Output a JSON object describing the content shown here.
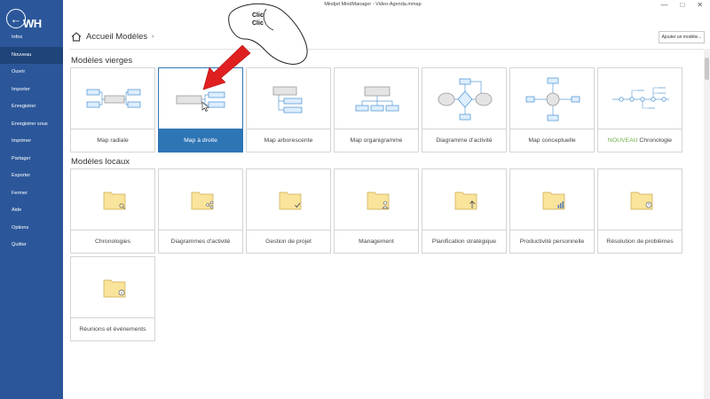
{
  "window": {
    "title": "Mindjet MindManager - Video-Agenda.mmap",
    "minimize": "—",
    "maximize": "□",
    "close": "✕"
  },
  "sidebar": {
    "logo_text": "WH",
    "items": [
      {
        "id": "infos",
        "label": "Infos"
      },
      {
        "id": "nouveau",
        "label": "Nouveau",
        "active": true
      },
      {
        "id": "ouvrir",
        "label": "Ouvrir"
      },
      {
        "id": "importer",
        "label": "Importer"
      },
      {
        "id": "enregistrer",
        "label": "Enregistrer"
      },
      {
        "id": "enregistrer-sous",
        "label": "Enregistrer sous"
      },
      {
        "id": "imprimer",
        "label": "Imprimer"
      },
      {
        "id": "partager",
        "label": "Partager"
      },
      {
        "id": "exporter",
        "label": "Exporter"
      },
      {
        "id": "fermer",
        "label": "Fermer"
      },
      {
        "id": "aide",
        "label": "Aide"
      },
      {
        "id": "options",
        "label": "Options"
      },
      {
        "id": "quitter",
        "label": "Quitter"
      }
    ]
  },
  "header": {
    "breadcrumb": "Accueil Modèles",
    "breadcrumb_chevron": "›",
    "add_model_label": "Ajouter un modèle..."
  },
  "annotation": {
    "line1": "Clic",
    "line2": "Clic"
  },
  "blank_templates": {
    "title": "Modèles vierges",
    "items": [
      {
        "id": "radiale",
        "label": "Map radiale"
      },
      {
        "id": "droite",
        "label": "Map à droite",
        "selected": true
      },
      {
        "id": "arborescente",
        "label": "Map arborescente"
      },
      {
        "id": "organigramme",
        "label": "Map organigramme"
      },
      {
        "id": "activite",
        "label": "Diagramme d'activité"
      },
      {
        "id": "conceptuelle",
        "label": "Map conceptuelle"
      },
      {
        "id": "chronologie",
        "badge": "NOUVEAU",
        "label": "Chronologie"
      }
    ]
  },
  "local_templates": {
    "title": "Modèles locaux",
    "items": [
      {
        "id": "chronologies",
        "label": "Chronologies",
        "glyph": "magnifier"
      },
      {
        "id": "diagrammes",
        "label": "Diagrammes d'activité",
        "glyph": "share"
      },
      {
        "id": "gestion",
        "label": "Gestion de projet",
        "glyph": "check"
      },
      {
        "id": "management",
        "label": "Management",
        "glyph": "person"
      },
      {
        "id": "planification",
        "label": "Planification stratégique",
        "glyph": "arrow"
      },
      {
        "id": "productivite",
        "label": "Productivité personnelle",
        "glyph": "bars"
      },
      {
        "id": "resolution",
        "label": "Résolution de problèmes",
        "glyph": "clock"
      },
      {
        "id": "reunions",
        "label": "Réunions et événements",
        "glyph": "info"
      }
    ]
  },
  "colors": {
    "sidebar": "#2b579a",
    "selected": "#2e75b6",
    "node_fill": "#ddeeff",
    "node_stroke": "#5b9bd5",
    "folder": "#f9e49b",
    "arrow": "#e02020",
    "nouveau": "#70ad47"
  }
}
